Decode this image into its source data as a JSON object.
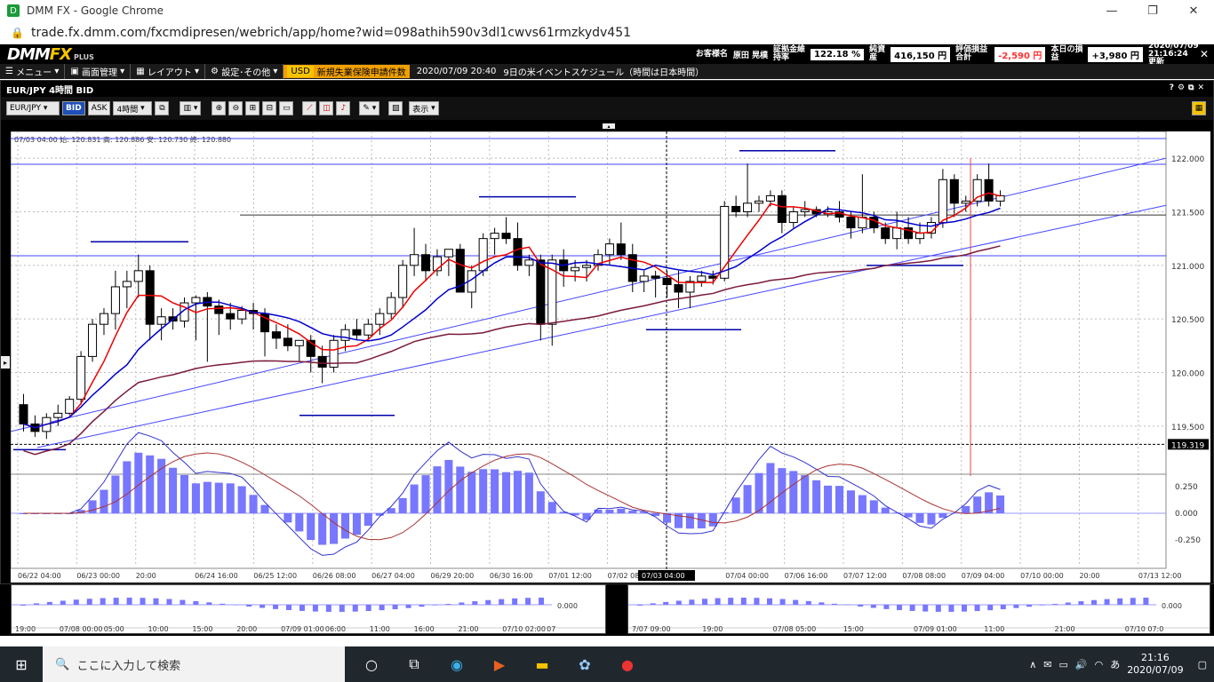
{
  "browser": {
    "title": "DMM FX - Google Chrome",
    "url": "trade.fx.dmm.com/fxcmdipresen/webrich/app/home?wid=098athih590v3dl1cwvs61rmzkydv451"
  },
  "app": {
    "logo_main": "DMM",
    "logo_fx": "FX",
    "logo_sub": "PLUS",
    "account": {
      "customer_label": "お客様名",
      "customer_name": "原田 晃樸",
      "margin_label": "証拠金維持率",
      "margin_value": "122.18 %",
      "equity_label": "純資産",
      "equity_value": "416,150 円",
      "pl_label": "評価損益合計",
      "pl_value": "-2,590 円",
      "today_label": "本日の損益",
      "today_value": "+3,980 円",
      "updated": "2020/07/09 21:16:24更新"
    },
    "menu": {
      "menu": "メニュー",
      "screen": "画面管理",
      "layout": "レイアウト",
      "settings": "設定･その他",
      "usd": "USD",
      "news": "新規失業保険申請件数",
      "event_time": "2020/07/09 20:40",
      "event_text": "9日の米イベントスケジュール（時間は日本時間）"
    },
    "pane_title": "EUR/JPY 4時間 BID",
    "toolbar": {
      "pair": "EUR/JPY",
      "bid": "BID",
      "ask": "ASK",
      "period": "4時間",
      "display": "表示"
    },
    "ohlc": "07/03 04:00 始: 120.831 高: 120.886 安: 120.730 終: 120.880",
    "crosshair_label": "07/03 04:00",
    "current_price": "119.319"
  },
  "chart_data": {
    "type": "candlestick",
    "title": "",
    "y_ticks": [
      "122.000",
      "121.500",
      "121.000",
      "120.500",
      "120.000",
      "119.500"
    ],
    "ylim": [
      119.25,
      122.2
    ],
    "x_ticks": [
      "06/22 04:00",
      "06/23 00:00",
      "20:00",
      "06/24 16:00",
      "06/25 12:00",
      "06/26 08:00",
      "06/27 04:00",
      "06/29 20:00",
      "06/30 16:00",
      "07/01 12:00",
      "07/02 08:00",
      "07/03 04:00",
      "07/04 00:00",
      "07/06 16:00",
      "07/07 12:00",
      "07/08 08:00",
      "07/09 04:00",
      "07/10 00:00",
      "20:00",
      "07/13 12:00"
    ],
    "candles": [
      [
        119.7,
        119.8,
        119.45,
        119.52
      ],
      [
        119.52,
        119.6,
        119.4,
        119.45
      ],
      [
        119.45,
        119.62,
        119.38,
        119.58
      ],
      [
        119.58,
        119.7,
        119.5,
        119.62
      ],
      [
        119.62,
        119.78,
        119.6,
        119.75
      ],
      [
        119.75,
        120.2,
        119.7,
        120.15
      ],
      [
        120.15,
        120.5,
        120.1,
        120.45
      ],
      [
        120.45,
        120.6,
        120.35,
        120.55
      ],
      [
        120.55,
        120.95,
        120.4,
        120.8
      ],
      [
        120.8,
        120.95,
        120.6,
        120.85
      ],
      [
        120.85,
        121.1,
        120.7,
        120.95
      ],
      [
        120.95,
        121.0,
        120.3,
        120.45
      ],
      [
        120.45,
        120.6,
        120.3,
        120.52
      ],
      [
        120.52,
        120.6,
        120.4,
        120.48
      ],
      [
        120.48,
        120.7,
        120.42,
        120.65
      ],
      [
        120.65,
        120.72,
        120.3,
        120.7
      ],
      [
        120.7,
        120.75,
        120.1,
        120.62
      ],
      [
        120.62,
        120.68,
        120.35,
        120.55
      ],
      [
        120.55,
        120.65,
        120.4,
        120.5
      ],
      [
        120.5,
        120.62,
        120.45,
        120.58
      ],
      [
        120.58,
        120.65,
        120.4,
        120.55
      ],
      [
        120.55,
        120.6,
        120.15,
        120.38
      ],
      [
        120.38,
        120.45,
        120.22,
        120.32
      ],
      [
        120.32,
        120.45,
        120.2,
        120.25
      ],
      [
        120.25,
        120.3,
        120.1,
        120.3
      ],
      [
        120.3,
        120.35,
        120.0,
        120.15
      ],
      [
        120.15,
        120.25,
        119.9,
        120.05
      ],
      [
        120.05,
        120.35,
        120.0,
        120.3
      ],
      [
        120.3,
        120.45,
        120.2,
        120.4
      ],
      [
        120.4,
        120.5,
        120.3,
        120.35
      ],
      [
        120.35,
        120.5,
        120.3,
        120.45
      ],
      [
        120.45,
        120.6,
        120.35,
        120.55
      ],
      [
        120.55,
        120.75,
        120.5,
        120.7
      ],
      [
        120.7,
        121.05,
        120.6,
        121.0
      ],
      [
        121.0,
        121.35,
        120.9,
        121.1
      ],
      [
        121.1,
        121.2,
        120.85,
        120.95
      ],
      [
        120.95,
        121.15,
        120.9,
        121.08
      ],
      [
        121.08,
        121.15,
        120.9,
        121.15
      ],
      [
        121.15,
        121.2,
        120.8,
        120.75
      ],
      [
        120.75,
        121.0,
        120.6,
        120.95
      ],
      [
        120.95,
        121.3,
        120.9,
        121.25
      ],
      [
        121.25,
        121.35,
        121.1,
        121.3
      ],
      [
        121.3,
        121.45,
        121.2,
        121.25
      ],
      [
        121.25,
        121.4,
        120.95,
        121.0
      ],
      [
        121.0,
        121.1,
        120.9,
        121.05
      ],
      [
        121.05,
        121.1,
        120.3,
        120.45
      ],
      [
        120.45,
        121.1,
        120.25,
        121.05
      ],
      [
        121.05,
        121.15,
        120.8,
        120.95
      ],
      [
        120.95,
        121.05,
        120.85,
        120.98
      ],
      [
        120.98,
        121.05,
        120.85,
        121.0
      ],
      [
        121.0,
        121.15,
        120.95,
        121.1
      ],
      [
        121.1,
        121.25,
        121.0,
        121.2
      ],
      [
        121.2,
        121.4,
        121.05,
        121.1
      ],
      [
        121.1,
        121.2,
        120.75,
        120.85
      ],
      [
        120.85,
        120.95,
        120.75,
        120.9
      ],
      [
        120.9,
        120.95,
        120.7,
        120.88
      ],
      [
        120.88,
        120.95,
        120.7,
        120.82
      ],
      [
        120.82,
        120.95,
        120.6,
        120.75
      ],
      [
        120.75,
        120.9,
        120.6,
        120.85
      ],
      [
        120.85,
        120.95,
        120.8,
        120.9
      ],
      [
        120.9,
        120.95,
        120.82,
        120.88
      ],
      [
        120.88,
        121.6,
        120.85,
        121.55
      ],
      [
        121.55,
        121.65,
        121.45,
        121.5
      ],
      [
        121.5,
        121.95,
        121.45,
        121.58
      ],
      [
        121.58,
        121.65,
        121.5,
        121.6
      ],
      [
        121.6,
        121.7,
        121.55,
        121.65
      ],
      [
        121.65,
        121.7,
        121.3,
        121.4
      ],
      [
        121.4,
        121.55,
        121.35,
        121.5
      ],
      [
        121.5,
        121.6,
        121.45,
        121.52
      ],
      [
        121.52,
        121.55,
        121.45,
        121.48
      ],
      [
        121.48,
        121.55,
        121.45,
        121.5
      ],
      [
        121.5,
        121.6,
        121.4,
        121.45
      ],
      [
        121.45,
        121.5,
        121.25,
        121.35
      ],
      [
        121.35,
        121.85,
        121.3,
        121.45
      ],
      [
        121.45,
        121.5,
        121.3,
        121.35
      ],
      [
        121.35,
        121.4,
        121.2,
        121.25
      ],
      [
        121.25,
        121.5,
        121.15,
        121.35
      ],
      [
        121.35,
        121.45,
        121.2,
        121.25
      ],
      [
        121.25,
        121.4,
        121.2,
        121.3
      ],
      [
        121.3,
        121.45,
        121.25,
        121.4
      ],
      [
        121.4,
        121.9,
        121.35,
        121.8
      ],
      [
        121.8,
        121.85,
        121.45,
        121.58
      ],
      [
        121.58,
        121.65,
        121.5,
        121.6
      ],
      [
        121.6,
        121.85,
        121.55,
        121.8
      ],
      [
        121.8,
        121.95,
        121.55,
        121.6
      ],
      [
        121.6,
        121.7,
        121.55,
        121.65
      ]
    ]
  },
  "bottom_left": {
    "ticks": [
      "19:00",
      "07/08 00:00",
      "05:00",
      "10:00",
      "15:00",
      "20:00",
      "07/09 01:00",
      "06:00",
      "11:00",
      "16:00",
      "21:00",
      "07/10 02:00",
      "07"
    ],
    "zero": "0.000"
  },
  "bottom_right": {
    "ticks": [
      "7/07 09:00",
      "19:00",
      "07/08 05:00",
      "15:00",
      "07/09 01:00",
      "11:00",
      "21:00",
      "07/10 07:0"
    ],
    "zero": "0.000"
  },
  "macd_ticks": [
    "0.250",
    "0.000",
    "-0.250"
  ],
  "taskbar": {
    "search": "ここに入力して検索",
    "time": "21:16",
    "date": "2020/07/09"
  }
}
